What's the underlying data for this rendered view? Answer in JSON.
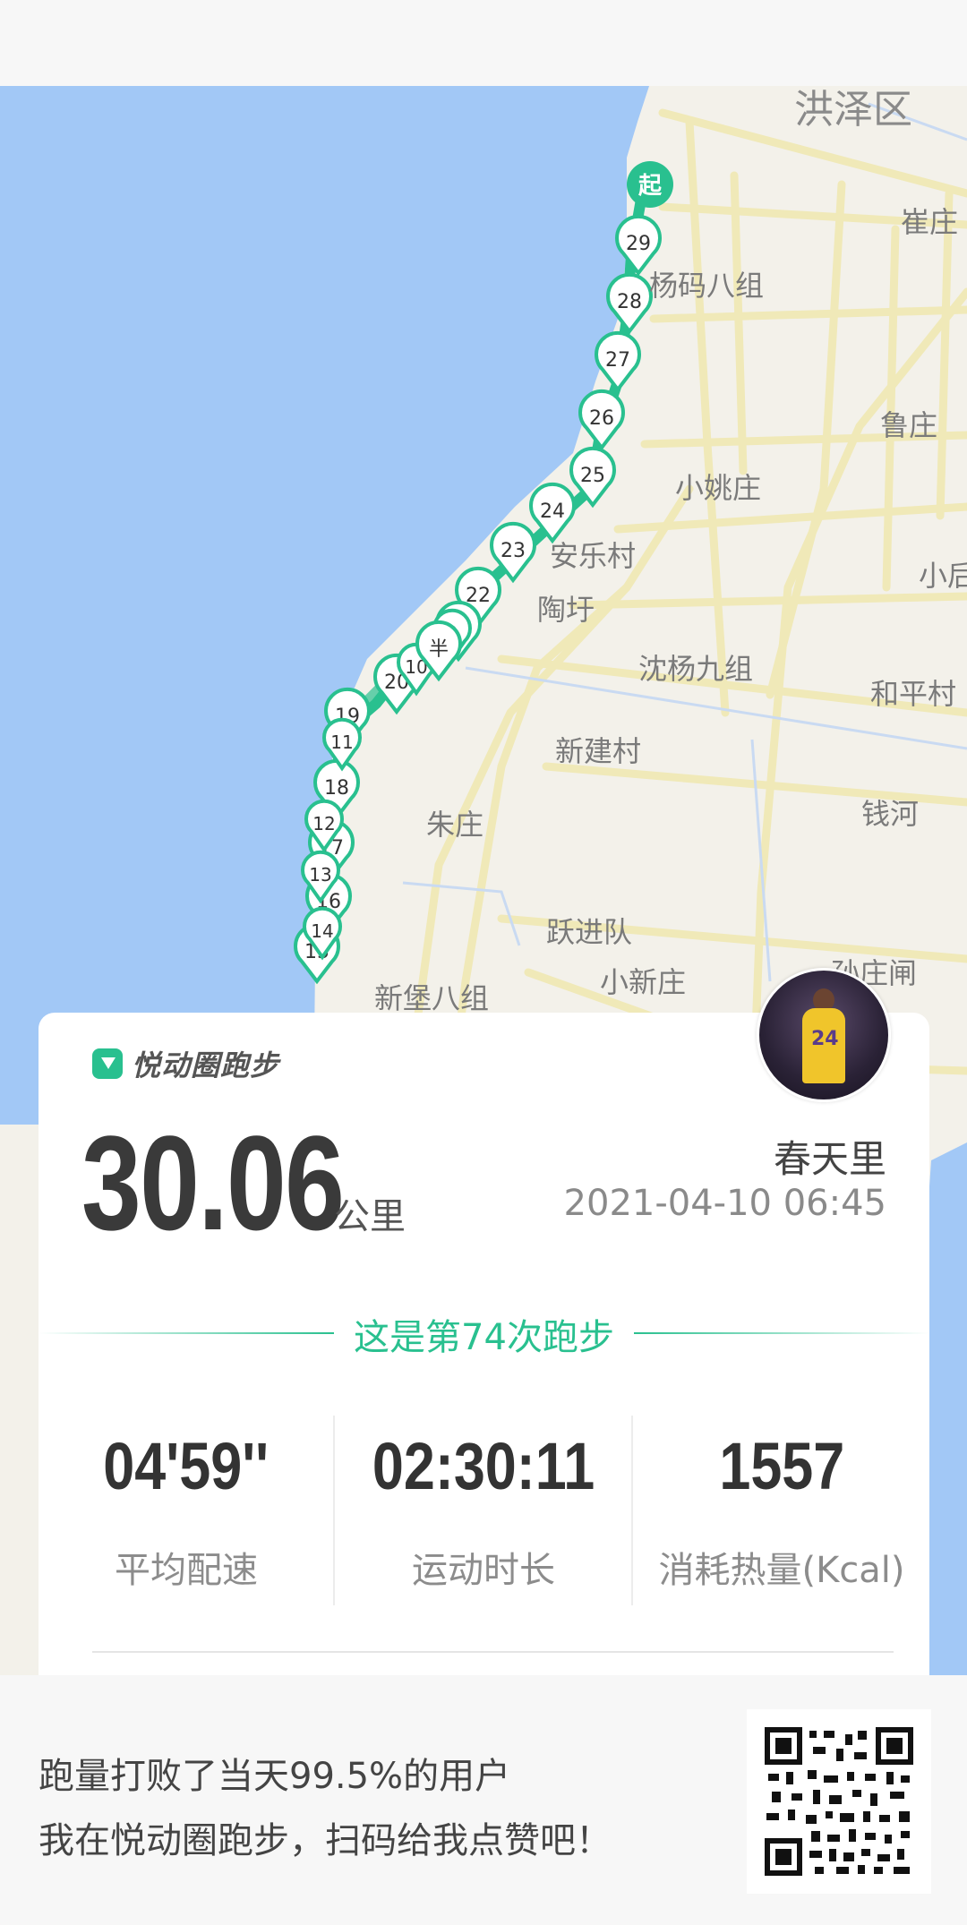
{
  "map": {
    "places": {
      "hongze": "洪泽区",
      "cuizhuang": "崔庄",
      "yangma": "杨码八组",
      "luzhuang": "鲁庄",
      "xiaoyao": "小姚庄",
      "anle": "安乐村",
      "xiaoju": "小后",
      "taowei": "陶圩",
      "shenyang": "沈杨九组",
      "heping": "和平村",
      "xinjian": "新建村",
      "qianhe": "钱河",
      "zhuzhuang": "朱庄",
      "yuejin": "跃进队",
      "xiaoxin": "小新庄",
      "sunzhuang": "孙庄闸",
      "xinbao": "新堡八组"
    },
    "start_marker": "起",
    "half_marker": "半",
    "km_markers": [
      "29",
      "28",
      "27",
      "26",
      "25",
      "24",
      "23",
      "22",
      "21",
      "20",
      "19",
      "18",
      "17",
      "16",
      "15",
      "14",
      "13",
      "12",
      "11",
      "10",
      "9"
    ]
  },
  "card": {
    "logo_text": "悦动圈跑步",
    "distance": "30.06",
    "unit": "公里",
    "username": "春天里",
    "datetime": "2021-04-10 06:45",
    "run_count": "这是第74次跑步",
    "stats": [
      {
        "value": "04'59''",
        "label": "平均配速"
      },
      {
        "value": "02:30:11",
        "label": "运动时长"
      },
      {
        "value": "1557",
        "label": "消耗热量(Kcal)"
      }
    ]
  },
  "footer": {
    "beat_text": "跑量打败了当天99.5%的用户",
    "share_text": "我在悦动圈跑步，扫码给我点赞吧！"
  },
  "colors": {
    "accent": "#29c08f",
    "water": "#a2c8f6",
    "land": "#f3f1ea",
    "road": "#f0e9b8"
  }
}
